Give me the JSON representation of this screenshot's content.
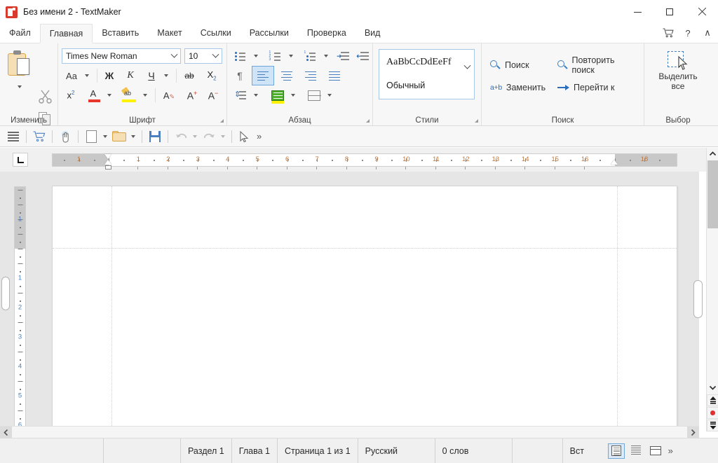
{
  "window": {
    "title": "Без имени 2 - TextMaker",
    "app_icon": "textmaker-icon",
    "minimize": "minimize-icon",
    "maximize": "maximize-icon",
    "close": "close-icon"
  },
  "tabs": [
    {
      "label": "Файл",
      "active": false
    },
    {
      "label": "Главная",
      "active": true
    },
    {
      "label": "Вставить",
      "active": false
    },
    {
      "label": "Макет",
      "active": false
    },
    {
      "label": "Ссылки",
      "active": false
    },
    {
      "label": "Рассылки",
      "active": false
    },
    {
      "label": "Проверка",
      "active": false
    },
    {
      "label": "Вид",
      "active": false
    }
  ],
  "tabstrip_right": [
    {
      "name": "cart-icon",
      "glyph": "🛒"
    },
    {
      "name": "help-icon",
      "glyph": "?"
    },
    {
      "name": "collapse-ribbon-icon",
      "glyph": "∧"
    }
  ],
  "ribbon": {
    "groups": [
      {
        "label": "Изменить"
      },
      {
        "label": "Шрифт"
      },
      {
        "label": "Абзац"
      },
      {
        "label": "Стили"
      },
      {
        "label": "Поиск"
      },
      {
        "label": "Выбор"
      }
    ],
    "clipboard": {
      "paste": "paste-button",
      "paste_more": "paste-dropdown",
      "cut": "cut-button",
      "copy": "copy-button",
      "format_painter": "format-painter-button"
    },
    "font": {
      "family_value": "Times New Roman",
      "size_value": "10",
      "change_case": "Aa",
      "bold": "Ж",
      "italic": "К",
      "underline": "Ч",
      "strikethrough": "ab",
      "subscript": "X",
      "subscript_index": "2",
      "superscript": "x",
      "superscript_index": "2",
      "font_color": "A",
      "font_color_hex": "#e8362a",
      "highlight": "ab",
      "highlight_hex": "#fff200",
      "clear_formatting": "A",
      "grow_font": "A",
      "grow_mark": "+",
      "shrink_font": "A",
      "shrink_mark": "-"
    },
    "paragraph": {
      "bullets": "bullet-list-button",
      "numbering": "numbered-list-button",
      "multilevel": "multilevel-list-button",
      "increase_indent": "increase-indent-button",
      "decrease_indent": "decrease-indent-button",
      "show_marks": "¶",
      "align_left": "align-left-button",
      "align_center": "align-center-button",
      "align_right": "align-right-button",
      "align_justify": "align-justify-button",
      "line_spacing": "line-spacing-button",
      "shading": "shading-button",
      "borders": "borders-button",
      "active_alignment": "align_left"
    },
    "styles": {
      "sample_text": "AaBbCcDdEeFf",
      "style_name": "Обычный",
      "expand": "styles-dropdown"
    },
    "search": {
      "find_label": "Поиск",
      "replace_label": "Заменить",
      "repeat_find_label": "Повторить поиск",
      "goto_label": "Перейти к",
      "replace_icon_text": "a+b"
    },
    "selection": {
      "select_all_line1": "Выделить",
      "select_all_line2": "все"
    }
  },
  "quick_access": [
    {
      "name": "menu-icon",
      "caret": false
    },
    {
      "name": "cart-icon",
      "caret": false
    },
    {
      "name": "touch-mode-icon",
      "caret": false
    },
    {
      "name": "new-document-icon",
      "caret": true
    },
    {
      "name": "open-folder-icon",
      "caret": true
    },
    {
      "name": "save-icon",
      "caret": false
    },
    {
      "name": "undo-icon",
      "caret": true
    },
    {
      "name": "redo-icon",
      "caret": true
    },
    {
      "name": "pointer-icon",
      "caret": false
    },
    {
      "name": "overflow-icon",
      "glyph": "»",
      "caret": false
    }
  ],
  "ruler": {
    "corner_tab_stop": "tab-stop-selector",
    "horizontal_numbers": [
      "1",
      "1",
      "2",
      "3",
      "4",
      "5",
      "6",
      "7",
      "8",
      "9",
      "10",
      "11",
      "12",
      "13",
      "14",
      "15",
      "16",
      "18"
    ],
    "vertical_numbers": [
      "1",
      "1",
      "2",
      "3",
      "4",
      "5",
      "6"
    ],
    "units_max": 18
  },
  "document": {
    "page_count": 1,
    "content": ""
  },
  "scrollbars": {
    "v_up": "scroll-up-icon",
    "v_down": "scroll-down-icon",
    "prev_page": "previous-page-icon",
    "select_object": "select-browse-object-icon",
    "next_page": "next-page-icon",
    "h_left": "scroll-left-icon",
    "select_object_hex": "#e03030"
  },
  "status_bar": {
    "section": "Раздел 1",
    "chapter": "Глава 1",
    "page": "Страница 1 из 1",
    "language": "Русский",
    "word_count": "0 слов",
    "insert_mode": "Вст",
    "views": [
      {
        "name": "view-layout-button",
        "active": true
      },
      {
        "name": "view-draft-button",
        "active": false
      },
      {
        "name": "view-outline-button",
        "active": false
      }
    ],
    "overflow": "»"
  }
}
